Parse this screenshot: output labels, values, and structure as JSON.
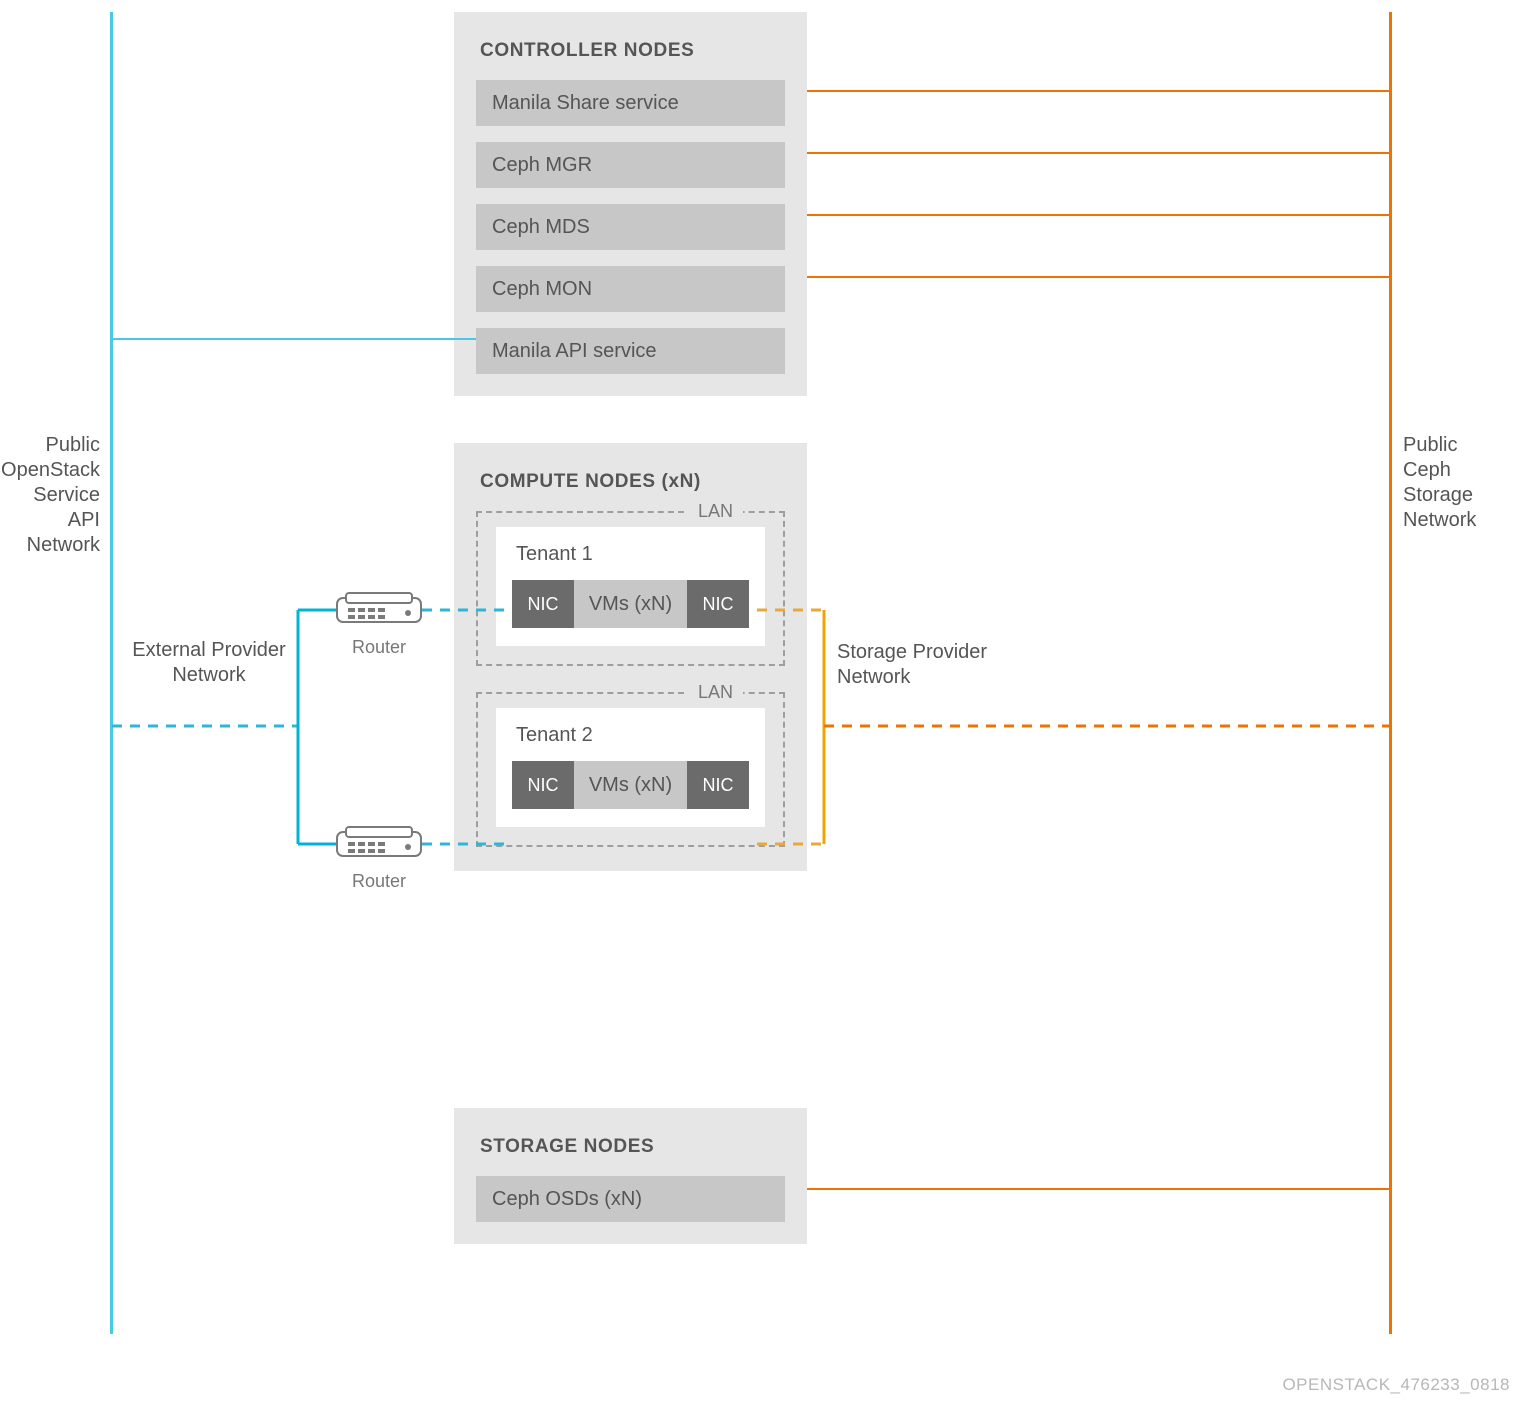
{
  "networks": {
    "left_label": "Public\nOpenStack\nService API\nNetwork",
    "right_label": "Public\nCeph Storage\nNetwork",
    "external_provider": "External Provider\nNetwork",
    "storage_provider": "Storage Provider\nNetwork"
  },
  "controller": {
    "title": "CONTROLLER NODES",
    "items": [
      "Manila Share service",
      "Ceph MGR",
      "Ceph MDS",
      "Ceph MON",
      "Manila API service"
    ]
  },
  "compute": {
    "title": "COMPUTE NODES  (xN)",
    "lan_tag": "LAN",
    "tenants": [
      {
        "name": "Tenant 1",
        "vms": "VMs  (xN)",
        "nic": "NIC"
      },
      {
        "name": "Tenant 2",
        "vms": "VMs  (xN)",
        "nic": "NIC"
      }
    ]
  },
  "storage": {
    "title": "STORAGE NODES",
    "items": [
      "Ceph OSDs  (xN)"
    ]
  },
  "router_label": "Router",
  "colors": {
    "blue": "#4ac9e3",
    "blue_dash": "#2fb6d6",
    "orange": "#eb7500",
    "orange_dash": "#e8a83c"
  },
  "footer": "OPENSTACK_476233_0818"
}
